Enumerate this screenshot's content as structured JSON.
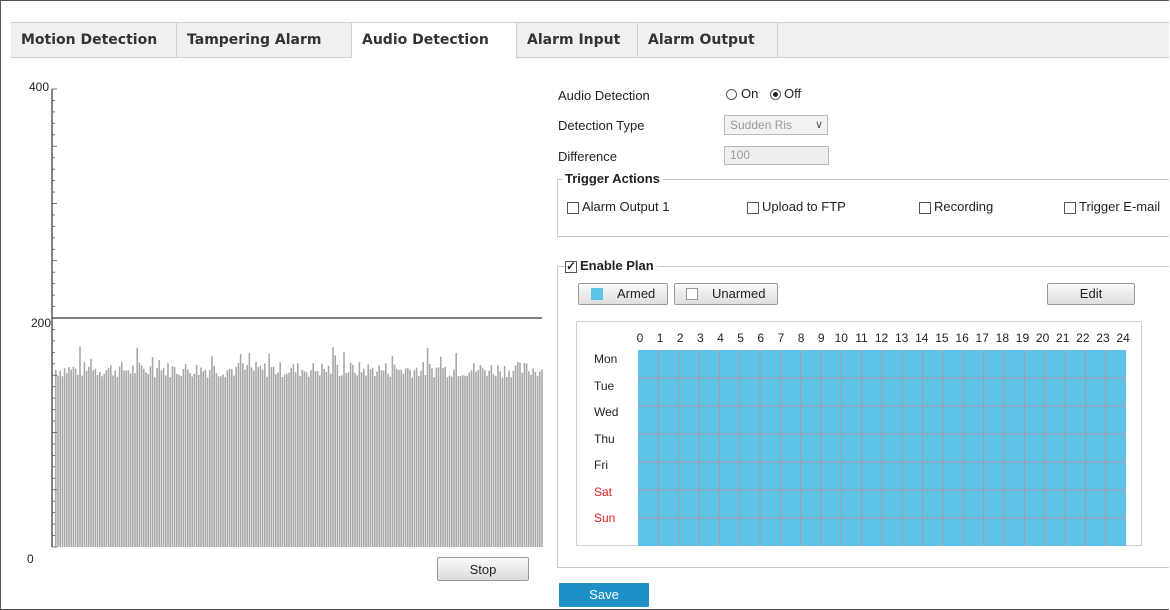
{
  "tabs": [
    {
      "label": "Motion Detection",
      "active": false
    },
    {
      "label": "Tampering Alarm",
      "active": false
    },
    {
      "label": "Audio Detection",
      "active": true
    },
    {
      "label": "Alarm Input",
      "active": false
    },
    {
      "label": "Alarm Output",
      "active": false
    }
  ],
  "graph": {
    "y_top_label": "400",
    "y_mid_label": "200",
    "y_bottom_label": "0",
    "threshold_value": 200,
    "y_max": 400,
    "stop_label": "Stop"
  },
  "form": {
    "audio_detection_label": "Audio Detection",
    "on_label": "On",
    "off_label": "Off",
    "audio_detection_value": "Off",
    "detection_type_label": "Detection Type",
    "detection_type_value": "Sudden Ris",
    "difference_label": "Difference",
    "difference_value": "100"
  },
  "trigger_actions": {
    "legend": "Trigger Actions",
    "items": [
      {
        "label": "Alarm Output 1",
        "checked": false
      },
      {
        "label": "Upload to FTP",
        "checked": false
      },
      {
        "label": "Recording",
        "checked": false
      },
      {
        "label": "Trigger E-mail",
        "checked": false
      }
    ]
  },
  "plan": {
    "enable_label": "Enable Plan",
    "enabled": true,
    "armed_label": "Armed",
    "unarmed_label": "Unarmed",
    "edit_label": "Edit",
    "armed_color": "#5ec3e6",
    "hours": [
      "0",
      "1",
      "2",
      "3",
      "4",
      "5",
      "6",
      "7",
      "8",
      "9",
      "10",
      "11",
      "12",
      "13",
      "14",
      "15",
      "16",
      "17",
      "18",
      "19",
      "20",
      "21",
      "22",
      "23",
      "24"
    ],
    "days": [
      {
        "label": "Mon",
        "weekend": false
      },
      {
        "label": "Tue",
        "weekend": false
      },
      {
        "label": "Wed",
        "weekend": false
      },
      {
        "label": "Thu",
        "weekend": false
      },
      {
        "label": "Fri",
        "weekend": false
      },
      {
        "label": "Sat",
        "weekend": true
      },
      {
        "label": "Sun",
        "weekend": true
      }
    ]
  },
  "save_label": "Save"
}
